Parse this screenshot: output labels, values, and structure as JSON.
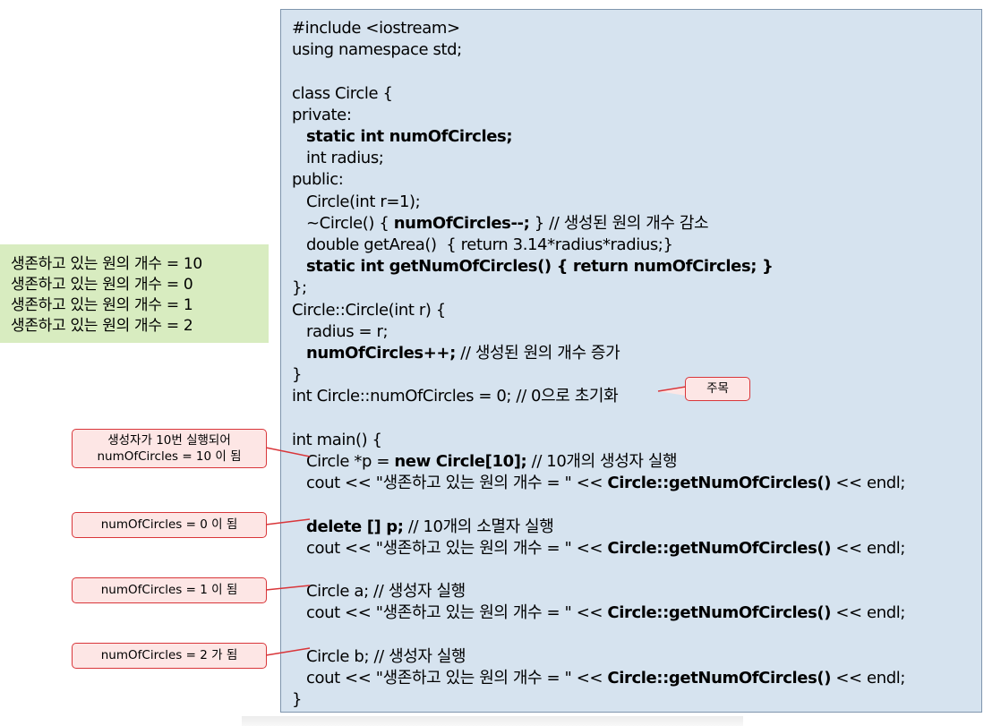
{
  "code": [
    {
      "segments": [
        {
          "t": "#include <iostream>",
          "b": false
        }
      ]
    },
    {
      "segments": [
        {
          "t": "using namespace std;",
          "b": false
        }
      ]
    },
    {
      "segments": [
        {
          "t": "",
          "b": false
        }
      ]
    },
    {
      "segments": [
        {
          "t": "class Circle {",
          "b": false
        }
      ]
    },
    {
      "segments": [
        {
          "t": "private:",
          "b": false
        }
      ]
    },
    {
      "segments": [
        {
          "t": "   ",
          "b": false
        },
        {
          "t": "static int numOfCircles;",
          "b": true
        }
      ]
    },
    {
      "segments": [
        {
          "t": "   int radius;",
          "b": false
        }
      ]
    },
    {
      "segments": [
        {
          "t": "public:",
          "b": false
        }
      ]
    },
    {
      "segments": [
        {
          "t": "   Circle(int r=1);",
          "b": false
        }
      ]
    },
    {
      "segments": [
        {
          "t": "   ~Circle() { ",
          "b": false
        },
        {
          "t": "numOfCircles--;",
          "b": true
        },
        {
          "t": " } // 생성된 원의 개수 감소",
          "b": false
        }
      ]
    },
    {
      "segments": [
        {
          "t": "   double getArea()  { return 3.14*radius*radius;}",
          "b": false
        }
      ]
    },
    {
      "segments": [
        {
          "t": "   ",
          "b": false
        },
        {
          "t": "static int getNumOfCircles() { return numOfCircles; }",
          "b": true
        }
      ]
    },
    {
      "segments": [
        {
          "t": "};",
          "b": false
        }
      ]
    },
    {
      "segments": [
        {
          "t": "Circle::Circle(int r) {",
          "b": false
        }
      ]
    },
    {
      "segments": [
        {
          "t": "   radius = r;",
          "b": false
        }
      ]
    },
    {
      "segments": [
        {
          "t": "   ",
          "b": false
        },
        {
          "t": "numOfCircles++;",
          "b": true
        },
        {
          "t": " // 생성된 원의 개수 증가",
          "b": false
        }
      ]
    },
    {
      "segments": [
        {
          "t": "}",
          "b": false
        }
      ]
    },
    {
      "segments": [
        {
          "t": "int Circle::numOfCircles = 0; // 0으로 초기화",
          "b": false
        }
      ]
    },
    {
      "segments": [
        {
          "t": "",
          "b": false
        }
      ]
    },
    {
      "segments": [
        {
          "t": "int main() {",
          "b": false
        }
      ]
    },
    {
      "segments": [
        {
          "t": "   Circle *p = ",
          "b": false
        },
        {
          "t": "new Circle[10];",
          "b": true
        },
        {
          "t": " // 10개의 생성자 실행",
          "b": false
        }
      ]
    },
    {
      "segments": [
        {
          "t": "   cout << \"생존하고 있는 원의 개수 = \" << ",
          "b": false
        },
        {
          "t": "Circle::getNumOfCircles()",
          "b": true
        },
        {
          "t": " << endl;",
          "b": false
        }
      ]
    },
    {
      "segments": [
        {
          "t": "",
          "b": false
        }
      ]
    },
    {
      "segments": [
        {
          "t": "   ",
          "b": false
        },
        {
          "t": "delete [] p;",
          "b": true
        },
        {
          "t": " // 10개의 소멸자 실행",
          "b": false
        }
      ]
    },
    {
      "segments": [
        {
          "t": "   cout << \"생존하고 있는 원의 개수 = \" << ",
          "b": false
        },
        {
          "t": "Circle::getNumOfCircles()",
          "b": true
        },
        {
          "t": " << endl;",
          "b": false
        }
      ]
    },
    {
      "segments": [
        {
          "t": "",
          "b": false
        }
      ]
    },
    {
      "segments": [
        {
          "t": "   Circle a; // 생성자 실행",
          "b": false
        }
      ]
    },
    {
      "segments": [
        {
          "t": "   cout << \"생존하고 있는 원의 개수 = \" << ",
          "b": false
        },
        {
          "t": "Circle::getNumOfCircles()",
          "b": true
        },
        {
          "t": " << endl;",
          "b": false
        }
      ]
    },
    {
      "segments": [
        {
          "t": "",
          "b": false
        }
      ]
    },
    {
      "segments": [
        {
          "t": "   Circle b; // 생성자 실행",
          "b": false
        }
      ]
    },
    {
      "segments": [
        {
          "t": "   cout << \"생존하고 있는 원의 개수 = \" << ",
          "b": false
        },
        {
          "t": "Circle::getNumOfCircles()",
          "b": true
        },
        {
          "t": " << endl;",
          "b": false
        }
      ]
    },
    {
      "segments": [
        {
          "t": "}",
          "b": false
        }
      ]
    }
  ],
  "output": [
    "생존하고 있는 원의 개수 = 10",
    "생존하고 있는 원의 개수 = 0",
    "생존하고 있는 원의 개수 = 1",
    "생존하고 있는 원의 개수 = 2"
  ],
  "callouts": {
    "note": "주목",
    "ctor_line1": "생성자가 10번 실행되어",
    "ctor_line2": "numOfCircles = 10 이 됨",
    "zero": "numOfCircles = 0 이 됨",
    "one": "numOfCircles = 1 이 됨",
    "two": "numOfCircles = 2 가 됨"
  },
  "colors": {
    "code_bg": "#d6e3ef",
    "output_bg": "#d8ecc0",
    "callout_bg": "#fde6e5",
    "callout_border": "#d9363a"
  }
}
